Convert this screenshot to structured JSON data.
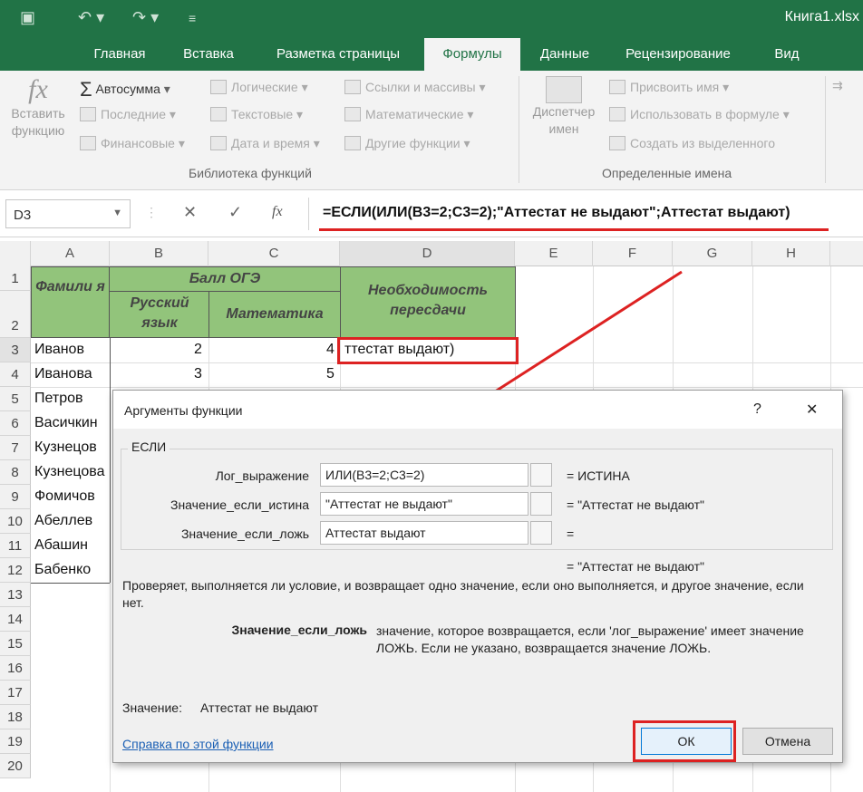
{
  "window": {
    "book_title": "Книга1.xlsx",
    "quick_access": [
      "save-icon",
      "undo-icon",
      "redo-icon",
      "customize-icon"
    ]
  },
  "tabs": [
    "Главная",
    "Вставка",
    "Разметка страницы",
    "Формулы",
    "Данные",
    "Рецензирование",
    "Вид"
  ],
  "ribbon": {
    "insert_function": "Вставить функцию",
    "autosum": "Автосумма",
    "recent": "Последние",
    "financial": "Финансовые",
    "logical": "Логические",
    "text": "Текстовые",
    "datetime": "Дата и время",
    "lookup": "Ссылки и массивы",
    "math": "Математические",
    "other": "Другие функции",
    "library_group": "Библиотека функций",
    "name_manager": "Диспетчер имен",
    "define_name": "Присвоить имя",
    "use_in_formula": "Использовать в формуле",
    "create_from_selection": "Создать из выделенного",
    "names_group": "Определенные имена"
  },
  "formula_bar": {
    "name_box": "D3",
    "fx": "fx",
    "formula": "=ЕСЛИ(ИЛИ(B3=2;C3=2);\"Аттестат не выдают\";Аттестат выдают)"
  },
  "sheet": {
    "columns": [
      "A",
      "B",
      "C",
      "D",
      "E",
      "F",
      "G",
      "H"
    ],
    "rows": [
      "1",
      "2",
      "3",
      "4",
      "5",
      "6",
      "7",
      "8",
      "9",
      "10",
      "11",
      "12",
      "13",
      "14",
      "15",
      "16",
      "17",
      "18",
      "19",
      "20"
    ],
    "header_surname": "Фамили я",
    "header_score": "Балл ОГЭ",
    "header_russian": "Русский язык",
    "header_math": "Математика",
    "header_retake": "Необходимость пересдачи",
    "surnames": [
      "Иванов",
      "Иванова",
      "Петров",
      "Васичкин",
      "Кузнецов",
      "Кузнецова",
      "Фомичов",
      "Абеллев",
      "Абашин",
      "Бабенко"
    ],
    "b_values": [
      "2",
      "3"
    ],
    "c_values": [
      "4",
      "5"
    ],
    "d3": "ттестат выдают)"
  },
  "dialog": {
    "title": "Аргументы функции",
    "help_glyph": "?",
    "close_glyph": "✕",
    "function_name": "ЕСЛИ",
    "args": [
      {
        "label": "Лог_выражение",
        "value": "ИЛИ(B3=2;C3=2)",
        "result": "=  ИСТИНА"
      },
      {
        "label": "Значение_если_истина",
        "value": "\"Аттестат не выдают\"",
        "result": "=  \"Аттестат не выдают\""
      },
      {
        "label": "Значение_если_ложь",
        "value": "Аттестат выдают",
        "result": "="
      }
    ],
    "overall_result": "=  \"Аттестат не выдают\"",
    "description": "Проверяет, выполняется ли условие, и возвращает одно значение, если оно выполняется, и другое значение, если нет.",
    "arg_name": "Значение_если_ложь",
    "arg_description": "значение, которое возвращается, если 'лог_выражение' имеет значение ЛОЖЬ. Если не указано, возвращается значение ЛОЖЬ.",
    "value_label": "Значение:",
    "value_text": "Аттестат не выдают",
    "help_link": "Справка по этой функции",
    "ok": "ОК",
    "cancel": "Отмена"
  },
  "colors": {
    "excel_green": "#217346",
    "header_green": "#92c47b",
    "annotation_red": "#d22222"
  }
}
